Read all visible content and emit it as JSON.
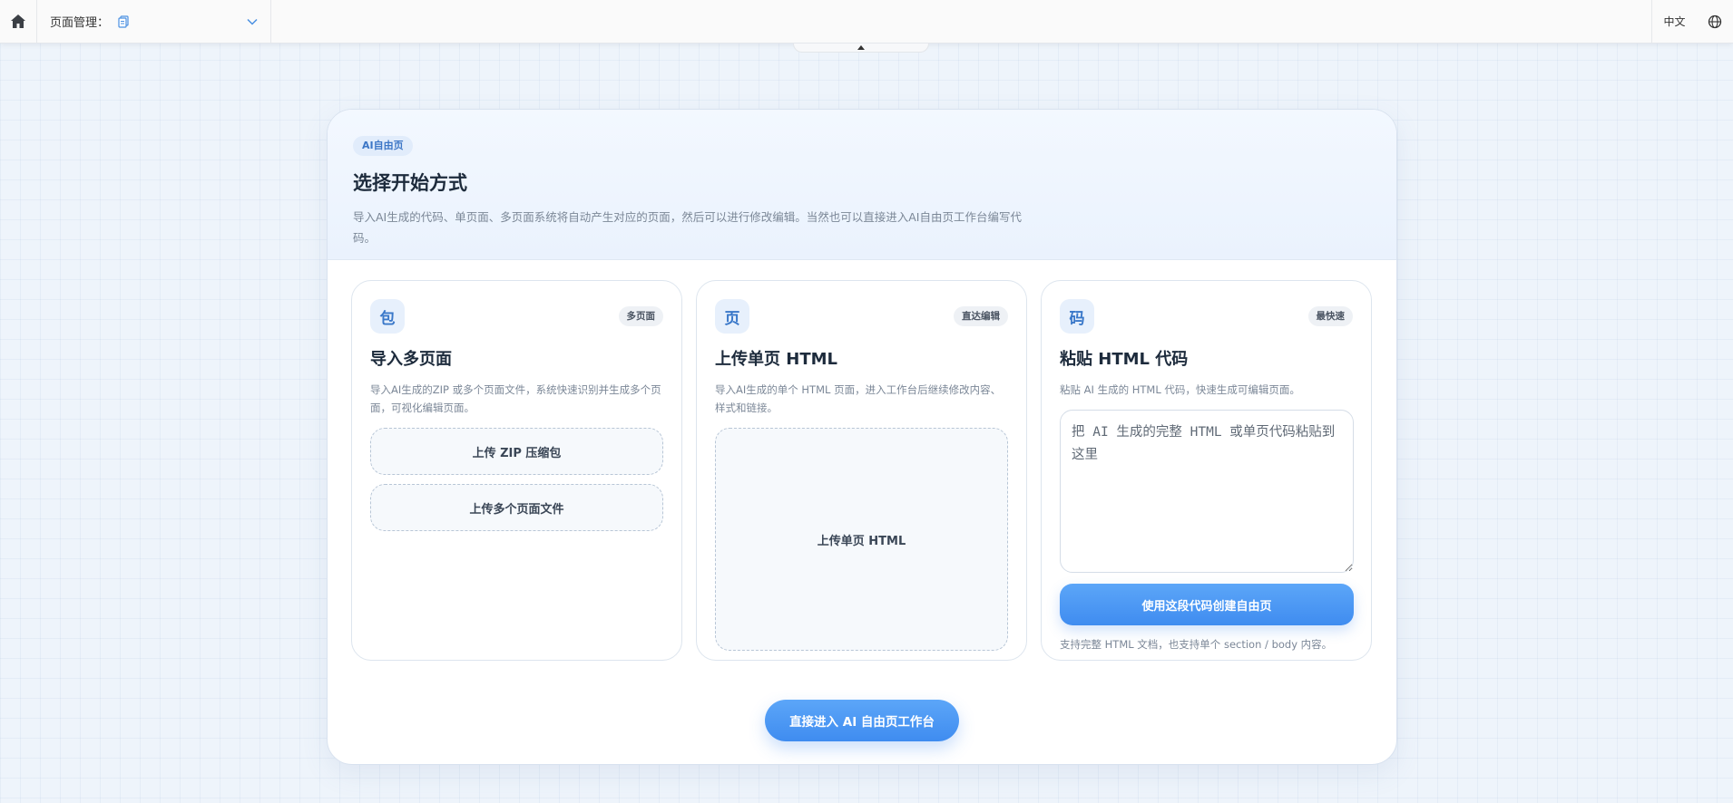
{
  "topbar": {
    "home_icon": "home-icon",
    "page_select_label": "页面管理：",
    "page_select_icon": "document-icon",
    "lang_label": "中文",
    "globe_icon": "globe-icon"
  },
  "colors": {
    "accent": "#4a97f4",
    "tag_bg": "#e1ecfb",
    "tag_text": "#3c76c6",
    "page_bg": "#eef4fb"
  },
  "panel": {
    "tag": "AI自由页",
    "title": "选择开始方式",
    "description": "导入AI生成的代码、单页面、多页面系统将自动产生对应的页面，然后可以进行修改编辑。当然也可以直接进入AI自由页工作台编写代码。",
    "enter_button": "直接进入 AI 自由页工作台"
  },
  "cards": [
    {
      "icon": "包",
      "badge": "多页面",
      "title": "导入多页面",
      "description": "导入AI生成的ZIP 或多个页面文件，系统快速识别并生成多个页面，可视化编辑页面。",
      "zip_button": "上传 ZIP 压缩包",
      "files_button": "上传多个页面文件"
    },
    {
      "icon": "页",
      "badge": "直达编辑",
      "title": "上传单页 HTML",
      "description": "导入AI生成的单个 HTML 页面，进入工作台后继续修改内容、样式和链接。",
      "upload_button": "上传单页 HTML"
    },
    {
      "icon": "码",
      "badge": "最快速",
      "title": "粘贴 HTML 代码",
      "description": "粘贴 AI 生成的 HTML 代码，快速生成可编辑页面。",
      "textarea_placeholder": "把 AI 生成的完整 HTML 或单页代码粘贴到这里",
      "create_button": "使用这段代码创建自由页",
      "footnote": "支持完整 HTML 文档，也支持单个 section / body 内容。"
    }
  ]
}
